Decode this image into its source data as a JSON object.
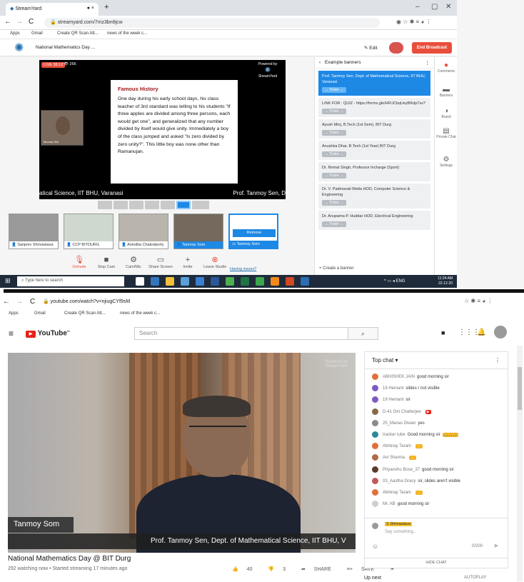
{
  "streamyard": {
    "tab_title": "StreamYard",
    "url": "streamyard.com/7mz3bn8jcw",
    "bookmarks": [
      "Apps",
      "Gmail",
      "Create QR Scan Att...",
      "news of the week c..."
    ],
    "broadcast_title": "National Mathematics Day ...",
    "edit_label": "Edit",
    "end_broadcast_label": "End Broadcast",
    "live_badge": "LIVE 38:12",
    "viewers": "266",
    "powered_by": "Powered by",
    "brand": "StreamYard",
    "slide": {
      "title": "Famous History",
      "text": "One day during his early school days, his class teacher of 3rd standard was telling to his students \"If three apples are divided among three persons, each would get one\", and generalized that any number divided by itself would give unity. Immediately a boy of the class jumped and asked \"Is zero divided by zero unity?\". This little boy was none other than Ramanujan."
    },
    "cam_label": "Tanmoy Sen",
    "lower_third_left": "atical Science, IIT BHU, Varanasi",
    "lower_third_right": "Prof. Tanmoy Sen, D",
    "participants": [
      "Sanjeev Shrivastava",
      "CCP BITDURG",
      "Anindita Chakraborty",
      "Tanmoy Som",
      "Tanmoy Som"
    ],
    "remove_label": "Remove",
    "tools": [
      "Unmute",
      "Stop Cam",
      "Cam/Mic",
      "Share Screen",
      "Invite",
      "Leave Studio"
    ],
    "having_issues": "Having issues?",
    "panel_title": "Example banners",
    "banners": [
      {
        "text": "Prof. Tanmoy Sen, Dept. of Mathematical Science, IIT BHU, Varanasi",
        "selected": true
      },
      {
        "text": "LINK FOR : QUIZ - https://forms.gle/HFUCbqUeyBKdp7ss7",
        "selected": false
      },
      {
        "text": "Ayush Minj, B.Tech (1st Sem), BIT Durg",
        "selected": false
      },
      {
        "text": "Anushka Dhar, B.Tech (1st Year) BIT Durg",
        "selected": false
      },
      {
        "text": "Dr. Nirmal Singh, Professor Incharge (Sport)",
        "selected": false
      },
      {
        "text": "Dr. V. Padmavati Metta HOD, Computer Science & Engineering",
        "selected": false
      },
      {
        "text": "Dr. Anupama P. Huddar HOD, Electrical Engineering",
        "selected": false
      }
    ],
    "ticker_label": "Ticker",
    "create_banner": "Create a banner",
    "rail": [
      "Comments",
      "Banners",
      "Brand",
      "Private Chat",
      "Settings"
    ],
    "taskbar_search": "Type here to search",
    "clock_time": "11:24 AM",
    "clock_date": "22-12-20",
    "lang": "ENG"
  },
  "youtube": {
    "url": "youtube.com/watch?v=njiugCYf9sM",
    "bookmarks": [
      "Apps",
      "Gmail",
      "Create QR Scan Att...",
      "news of the week c..."
    ],
    "logo": "YouTube",
    "logo_region": "IN",
    "search_placeholder": "Search",
    "watermark": "Powered by StreamYard",
    "nameplate": "Tanmoy Som",
    "lower_third": "Prof. Tanmoy Sen, Dept. of Mathematical Science, IIT BHU, V",
    "video_title": "National Mathematics Day @ BIT Durg",
    "video_meta": "292 watching now • Started streaming 17 minutes ago",
    "likes": "40",
    "dislikes": "3",
    "share_label": "SHARE",
    "save_label": "SAVE",
    "chat_header": "Top chat",
    "messages": [
      {
        "author": "ABHISHEK JAIN",
        "text": "good morning sir",
        "emoji": "",
        "color": "#e0703a"
      },
      {
        "author": "19 Hemant",
        "text": "slides r not visible",
        "emoji": "",
        "color": "#7a5cc0"
      },
      {
        "author": "19 Hemant",
        "text": "sir",
        "emoji": "",
        "color": "#7a5cc0"
      },
      {
        "author": "D-41 Om Chatterjee",
        "text": "",
        "emoji": "▶",
        "color": "#8a6a44"
      },
      {
        "author": "25_Manas Diwan",
        "text": "yes",
        "emoji": "",
        "color": "#8a8a8a"
      },
      {
        "author": "tracker tube",
        "text": "Good morning sir",
        "emoji": "🙏🙏🙏",
        "color": "#2a8a9a"
      },
      {
        "author": "Abhinay Taram",
        "text": "",
        "emoji": "👋",
        "color": "#e0703a"
      },
      {
        "author": "Avi Sharma",
        "text": "",
        "emoji": "👋",
        "color": "#b06a4a"
      },
      {
        "author": "Priyanshu Bose_37",
        "text": "good morning sir",
        "emoji": "",
        "color": "#5a3a2a"
      },
      {
        "author": "03_Aastha Gracy",
        "text": "sir, slides aren't visible",
        "emoji": "",
        "color": "#c05a5a"
      },
      {
        "author": "Abhinay Taram",
        "text": "",
        "emoji": "👋",
        "color": "#e0703a"
      },
      {
        "author": "Mr. AB",
        "text": "good morning sir",
        "emoji": "",
        "color": "#cfcfcf"
      }
    ],
    "compose_user": "S Shrivastava",
    "compose_placeholder": "Say something...",
    "char_count": "0/200",
    "hide_chat": "HIDE CHAT",
    "up_next": "Up next",
    "autoplay": "AUTOPLAY"
  }
}
